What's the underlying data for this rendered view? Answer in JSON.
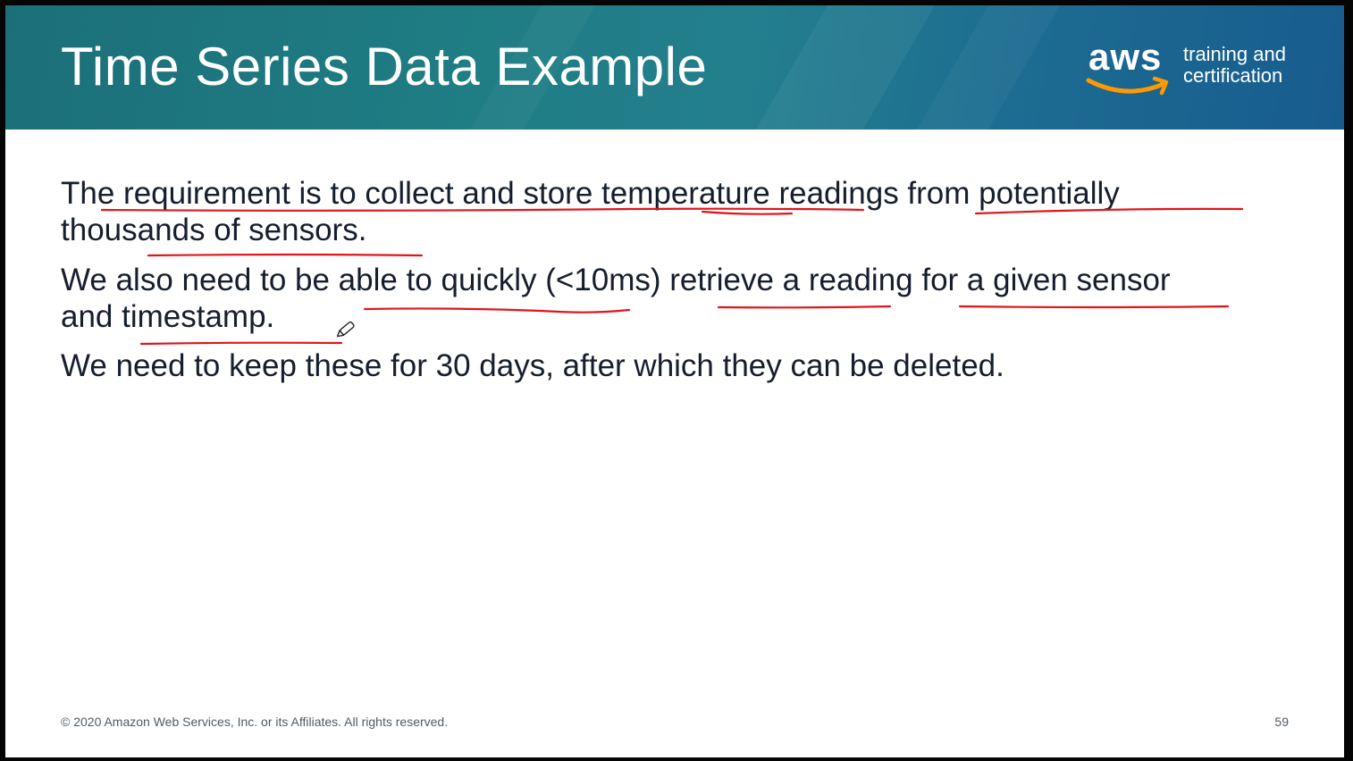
{
  "slide": {
    "title": "Time Series Data Example",
    "logo": {
      "wordmark": "aws",
      "tagline_line1": "training and",
      "tagline_line2": "certification"
    },
    "paragraphs": [
      {
        "line1": "The requirement is to collect and store temperature readings from potentially",
        "line2": "thousands of sensors."
      },
      {
        "line1": "We also need to be able to quickly (<10ms) retrieve a reading for a given sensor",
        "line2": "and timestamp."
      },
      {
        "line1": "We need to keep these for 30 days, after which they can be deleted."
      }
    ],
    "footer": "© 2020 Amazon Web Services, Inc. or its Affiliates. All rights reserved.",
    "page_number": "59"
  },
  "annotations": {
    "ink_color": "#e0151b",
    "icon": "pen-cursor-icon"
  },
  "colors": {
    "header_teal": "#1f7d84",
    "header_blue": "#175c8e",
    "body_text": "#161e2d",
    "aws_orange": "#ff9900"
  }
}
